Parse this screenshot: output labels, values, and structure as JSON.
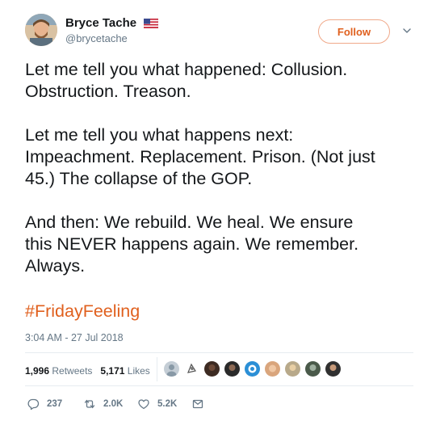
{
  "author": {
    "name": "Bryce Tache",
    "handle": "@brycetache"
  },
  "follow_label": "Follow",
  "text": {
    "p1_l1": "Let me tell you what happened: Collusion.",
    "p1_l2": "Obstruction. Treason.",
    "p2_l1": "Let me tell you what happens next:",
    "p2_l2": "Impeachment. Replacement. Prison. (Not just",
    "p2_l3": "45.) The collapse of the GOP.",
    "p3_l1": "And then: We rebuild. We heal. We ensure",
    "p3_l2": "this NEVER happens again. We remember.",
    "p3_l3": "Always."
  },
  "hashtag": "#FridayFeeling",
  "timestamp": "3:04 AM - 27 Jul 2018",
  "stats": {
    "retweets_count": "1,996",
    "retweets_label": "Retweets",
    "likes_count": "5,171",
    "likes_label": "Likes"
  },
  "actions": {
    "replies": "237",
    "retweets": "2.0K",
    "likes": "5.2K"
  },
  "colors": {
    "accent": "#e0601e",
    "muted": "#657786",
    "divider": "#e6ecf0"
  },
  "icons": [
    "flag-icon",
    "caret-down-icon",
    "reply-icon",
    "retweet-icon",
    "heart-icon",
    "envelope-icon"
  ]
}
